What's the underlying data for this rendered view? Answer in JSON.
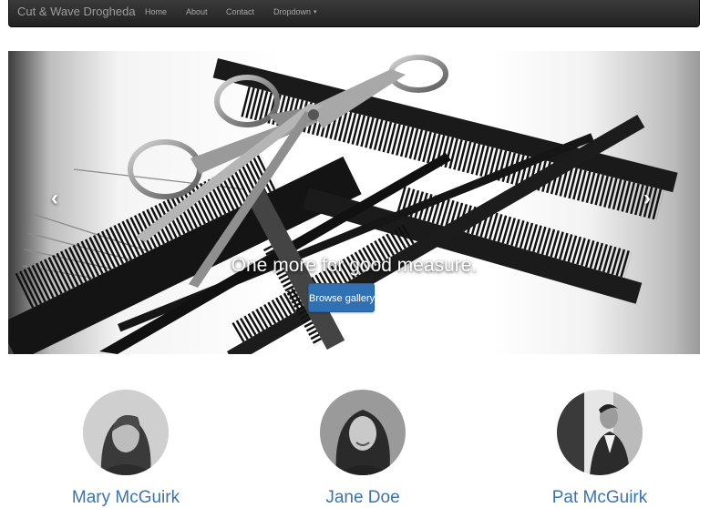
{
  "navbar": {
    "brand": "Cut & Wave Drogheda",
    "links": [
      "Home",
      "About",
      "Contact"
    ],
    "dropdown_label": "Dropdown",
    "dropdown_caret": "▾"
  },
  "carousel": {
    "caption": "One more for good measure.",
    "button_label": "Browse gallery",
    "prev_glyph": "‹",
    "next_glyph": "›",
    "slide_count": 3,
    "active_slide": 3,
    "image": "combs-and-scissors-photo"
  },
  "team": [
    {
      "name": "Mary McGuirk",
      "photo": "woman-portrait-photo"
    },
    {
      "name": "Jane Doe",
      "photo": "woman-portrait-photo"
    },
    {
      "name": "Pat McGuirk",
      "photo": "man-portrait-photo"
    }
  ],
  "colors": {
    "navbar_bg": "#222222",
    "primary_button": "#3071b3",
    "name_link": "#3a73ad"
  }
}
